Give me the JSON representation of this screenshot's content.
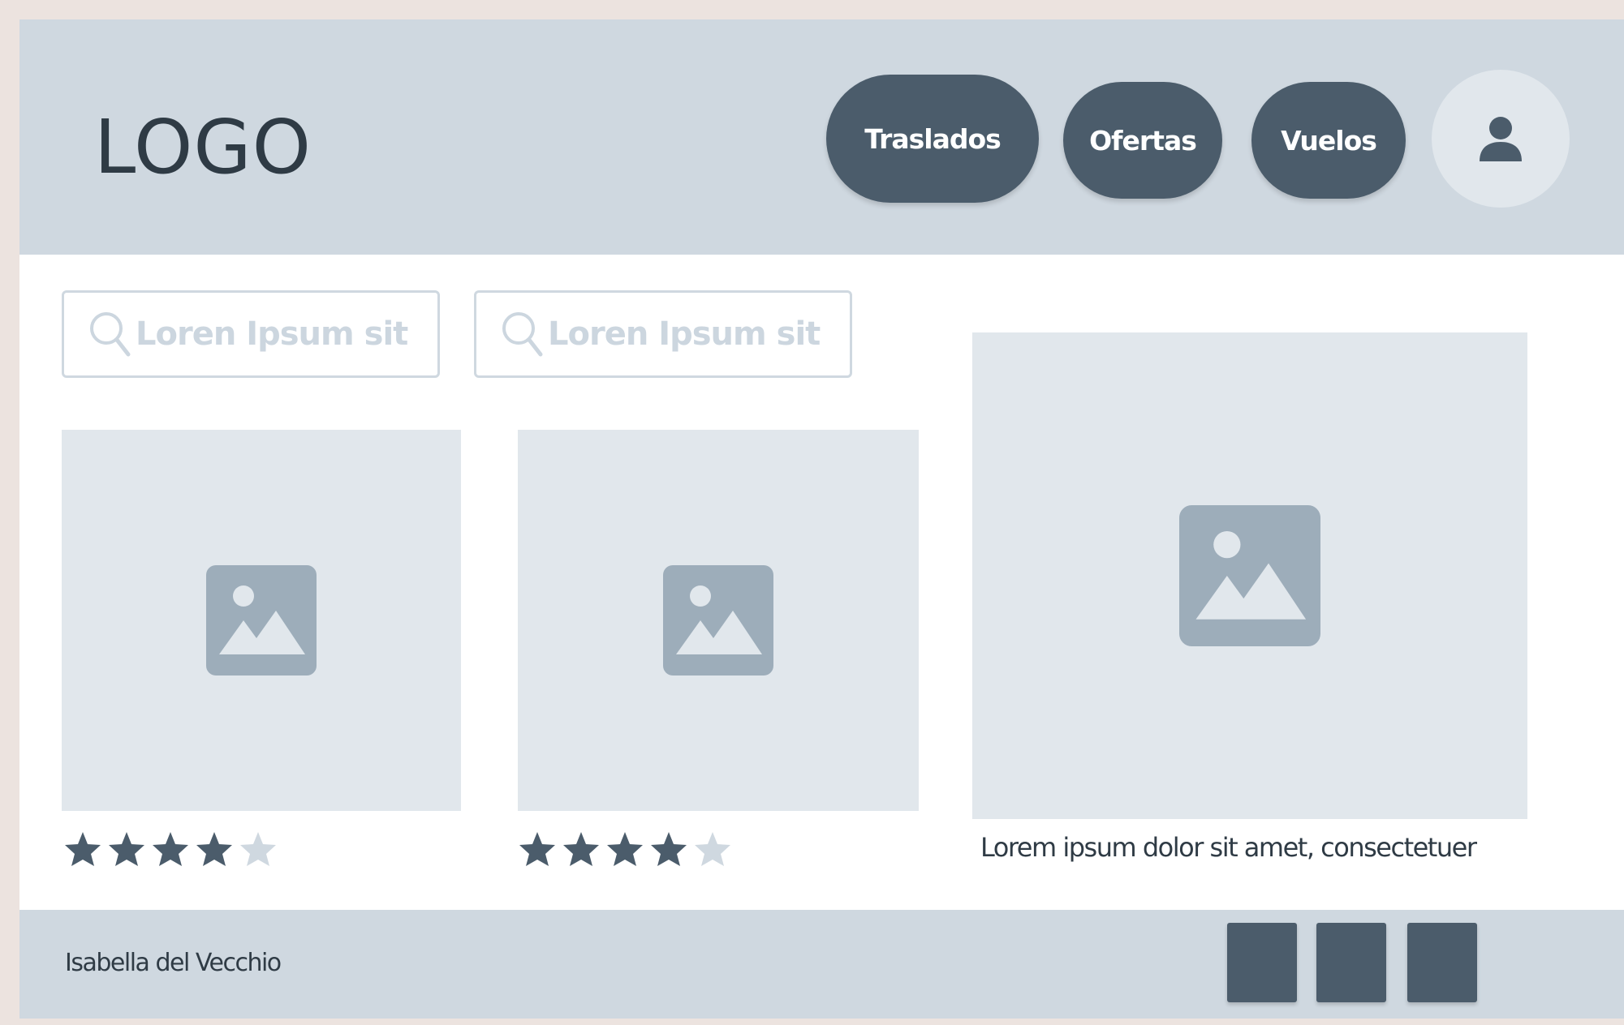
{
  "header": {
    "logo": "LOGO",
    "nav": [
      {
        "label": "Traslados"
      },
      {
        "label": "Ofertas"
      },
      {
        "label": "Vuelos"
      }
    ],
    "avatar_icon": "user-icon"
  },
  "search": [
    {
      "placeholder": "Loren Ipsum sit",
      "icon": "search-icon"
    },
    {
      "placeholder": "Loren Ipsum sit",
      "icon": "search-icon"
    }
  ],
  "cards": [
    {
      "icon": "image-placeholder-icon",
      "rating": 4,
      "max_rating": 5
    },
    {
      "icon": "image-placeholder-icon",
      "rating": 4,
      "max_rating": 5
    },
    {
      "icon": "image-placeholder-icon",
      "caption": "Lorem ipsum dolor sit amet, consectetuer"
    }
  ],
  "footer": {
    "author": "Isabella del Vecchio",
    "squares": 3
  },
  "colors": {
    "header_bg": "#cfd8e0",
    "accent": "#4b5c6b",
    "placeholder_bg": "#e1e7ec",
    "image_icon": "#9dadba",
    "star_empty": "#cfd8e0",
    "text": "#2f3b45"
  }
}
